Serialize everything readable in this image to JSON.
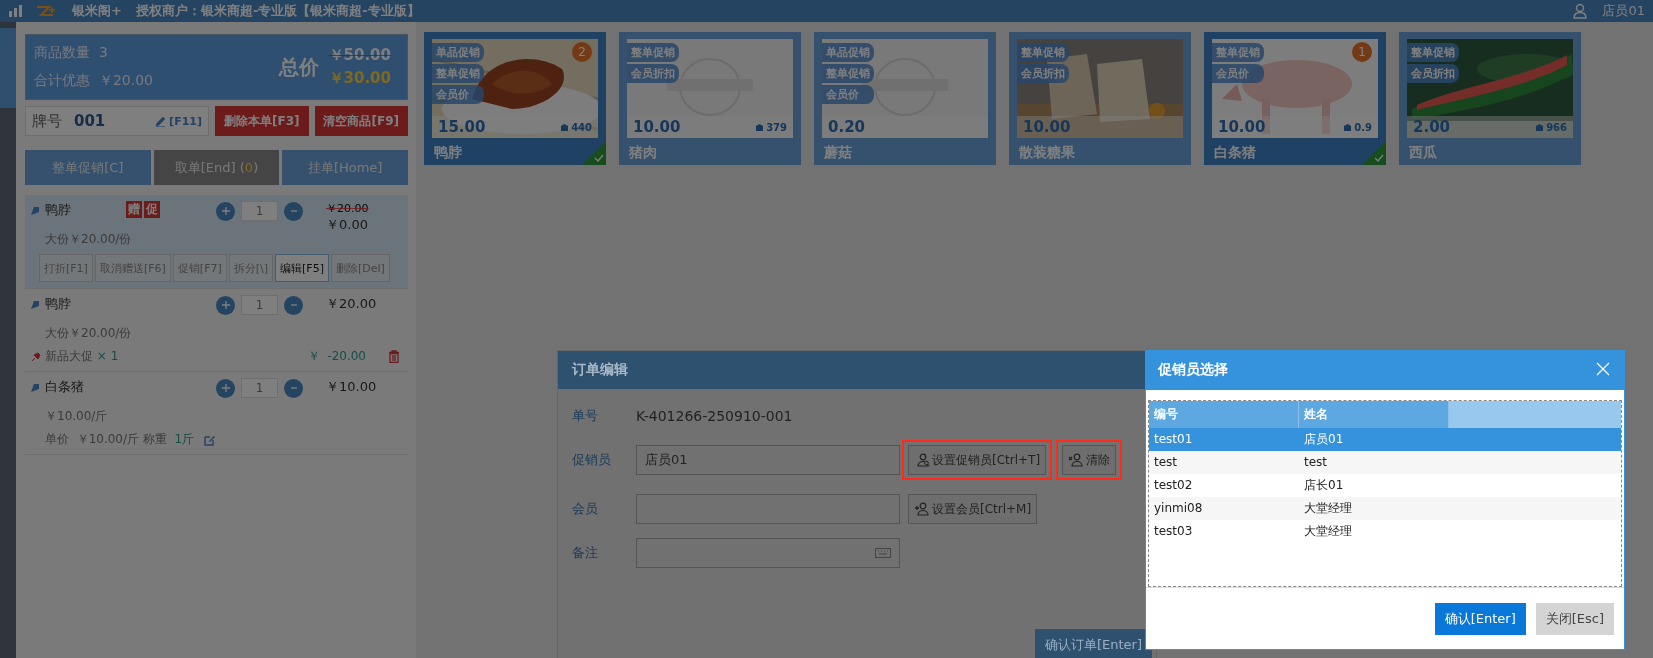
{
  "top_bar": {
    "app": "银米阁+",
    "merchant": "授权商户：银米商超-专业版【银米商超-专业版】",
    "user": "店员01"
  },
  "summary": {
    "count_label": "商品数量",
    "count": "3",
    "discount_label": "合计优惠",
    "discount": "￥20.00",
    "total_label": "总价",
    "original_total": "￥50.00",
    "total": "￥30.00"
  },
  "tag_row": {
    "label": "牌号",
    "value": "001",
    "shortcut": "[F11]",
    "buttons": [
      "删除本单[F3]",
      "清空商品[F9]"
    ]
  },
  "order_tabs": [
    {
      "label": "整单促销[C]",
      "kind": "blue"
    },
    {
      "label": "取单[End] (",
      "count": "0",
      "suffix": ")",
      "kind": "grey"
    },
    {
      "label": "挂单[Home]",
      "kind": "blue"
    }
  ],
  "items": [
    {
      "name": "鸭脖",
      "selected": true,
      "tags": [
        "赠",
        "促"
      ],
      "qty": "1",
      "old_price": "￥20.00",
      "price": "￥0.00",
      "spec": "大份￥20.00/份",
      "actions": [
        {
          "label": "打折[F1]",
          "selected": false
        },
        {
          "label": "取消赠送[F6]",
          "selected": false
        },
        {
          "label": "促销[F7]",
          "selected": false
        },
        {
          "label": "拆分[\\]",
          "selected": false
        },
        {
          "label": "编辑[F5]",
          "selected": true
        },
        {
          "label": "删除[Del]",
          "selected": false
        }
      ]
    },
    {
      "name": "鸭脖",
      "selected": false,
      "qty": "1",
      "price": "￥20.00",
      "spec": "大份￥20.00/份",
      "promo": {
        "name": "新品大促",
        "times": "× 1",
        "currency": "￥",
        "amount": "-20.00"
      }
    },
    {
      "name": "白条猪",
      "selected": false,
      "qty": "1",
      "price": "￥10.00",
      "spec": "￥10.00/斤",
      "weight": {
        "unit_label": "单价",
        "unit_price": "￥10.00/斤",
        "weigh_label": "称重",
        "value": "1斤"
      }
    }
  ],
  "products": [
    {
      "name": "鸭脖",
      "price": "15.00",
      "stock": "440",
      "promotions": [
        "单品促销",
        "整单促销",
        "会员价"
      ],
      "count": "2",
      "selected": true
    },
    {
      "name": "猪肉",
      "price": "10.00",
      "stock": "379",
      "promotions": [
        "整单促销",
        "会员折扣"
      ],
      "selected": false
    },
    {
      "name": "蘑菇",
      "price": "0.20",
      "promotions": [
        "单品促销",
        "整单促销",
        "会员价"
      ],
      "selected": false
    },
    {
      "name": "散装糖果",
      "price": "10.00",
      "promotions": [
        "整单促销",
        "会员折扣"
      ],
      "selected": false
    },
    {
      "name": "白条猪",
      "price": "10.00",
      "stock": "0.9",
      "promotions": [
        "整单促销",
        "会员价"
      ],
      "count": "1",
      "selected": true
    },
    {
      "name": "西瓜",
      "price": "2.00",
      "stock": "966",
      "promotions": [
        "整单促销",
        "会员折扣"
      ],
      "selected": false
    }
  ],
  "order_dialog": {
    "title": "订单编辑",
    "order_no_label": "单号",
    "order_no": "K-401266-250910-001",
    "fields": [
      {
        "label": "促销员",
        "value": "店员01",
        "kind": "text",
        "buttons": [
          {
            "label": "设置促销员[Ctrl+T]",
            "highlighted": true
          },
          {
            "label": "清除",
            "highlighted": true
          }
        ]
      },
      {
        "label": "会员",
        "kind": "text",
        "buttons": [
          {
            "label": "设置会员[Ctrl+M]",
            "highlighted": false
          }
        ]
      },
      {
        "label": "备注",
        "kind": "keyboard"
      }
    ],
    "confirm": "确认订单[Enter]"
  },
  "picker_dialog": {
    "title": "促销员选择",
    "columns": [
      "编号",
      "姓名"
    ],
    "rows": [
      {
        "id": "test01",
        "name": "店员01",
        "selected": true
      },
      {
        "id": "test",
        "name": "test",
        "selected": false
      },
      {
        "id": "test02",
        "name": "店长01",
        "selected": false
      },
      {
        "id": "yinmi08",
        "name": "大堂经理",
        "selected": false
      },
      {
        "id": "test03",
        "name": "大堂经理",
        "selected": false
      }
    ],
    "confirm": "确认[Enter]",
    "close": "关闭[Esc]"
  }
}
